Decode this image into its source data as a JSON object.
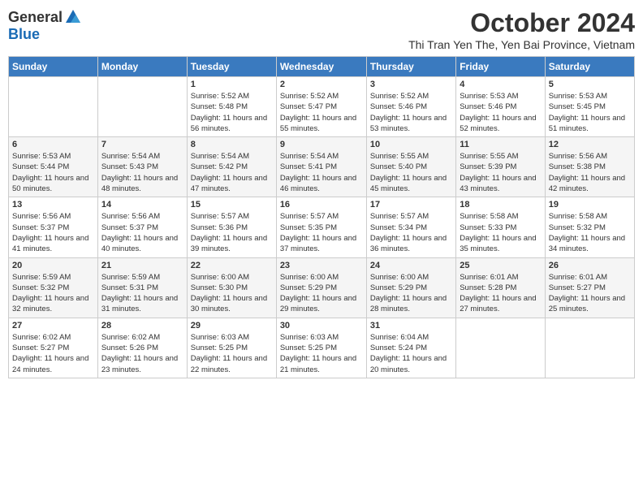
{
  "header": {
    "logo": {
      "general": "General",
      "blue": "Blue"
    },
    "title": "October 2024",
    "subtitle": "Thi Tran Yen The, Yen Bai Province, Vietnam"
  },
  "days_of_week": [
    "Sunday",
    "Monday",
    "Tuesday",
    "Wednesday",
    "Thursday",
    "Friday",
    "Saturday"
  ],
  "weeks": [
    [
      {
        "day": "",
        "info": ""
      },
      {
        "day": "",
        "info": ""
      },
      {
        "day": "1",
        "info": "Sunrise: 5:52 AM\nSunset: 5:48 PM\nDaylight: 11 hours and 56 minutes."
      },
      {
        "day": "2",
        "info": "Sunrise: 5:52 AM\nSunset: 5:47 PM\nDaylight: 11 hours and 55 minutes."
      },
      {
        "day": "3",
        "info": "Sunrise: 5:52 AM\nSunset: 5:46 PM\nDaylight: 11 hours and 53 minutes."
      },
      {
        "day": "4",
        "info": "Sunrise: 5:53 AM\nSunset: 5:46 PM\nDaylight: 11 hours and 52 minutes."
      },
      {
        "day": "5",
        "info": "Sunrise: 5:53 AM\nSunset: 5:45 PM\nDaylight: 11 hours and 51 minutes."
      }
    ],
    [
      {
        "day": "6",
        "info": "Sunrise: 5:53 AM\nSunset: 5:44 PM\nDaylight: 11 hours and 50 minutes."
      },
      {
        "day": "7",
        "info": "Sunrise: 5:54 AM\nSunset: 5:43 PM\nDaylight: 11 hours and 48 minutes."
      },
      {
        "day": "8",
        "info": "Sunrise: 5:54 AM\nSunset: 5:42 PM\nDaylight: 11 hours and 47 minutes."
      },
      {
        "day": "9",
        "info": "Sunrise: 5:54 AM\nSunset: 5:41 PM\nDaylight: 11 hours and 46 minutes."
      },
      {
        "day": "10",
        "info": "Sunrise: 5:55 AM\nSunset: 5:40 PM\nDaylight: 11 hours and 45 minutes."
      },
      {
        "day": "11",
        "info": "Sunrise: 5:55 AM\nSunset: 5:39 PM\nDaylight: 11 hours and 43 minutes."
      },
      {
        "day": "12",
        "info": "Sunrise: 5:56 AM\nSunset: 5:38 PM\nDaylight: 11 hours and 42 minutes."
      }
    ],
    [
      {
        "day": "13",
        "info": "Sunrise: 5:56 AM\nSunset: 5:37 PM\nDaylight: 11 hours and 41 minutes."
      },
      {
        "day": "14",
        "info": "Sunrise: 5:56 AM\nSunset: 5:37 PM\nDaylight: 11 hours and 40 minutes."
      },
      {
        "day": "15",
        "info": "Sunrise: 5:57 AM\nSunset: 5:36 PM\nDaylight: 11 hours and 39 minutes."
      },
      {
        "day": "16",
        "info": "Sunrise: 5:57 AM\nSunset: 5:35 PM\nDaylight: 11 hours and 37 minutes."
      },
      {
        "day": "17",
        "info": "Sunrise: 5:57 AM\nSunset: 5:34 PM\nDaylight: 11 hours and 36 minutes."
      },
      {
        "day": "18",
        "info": "Sunrise: 5:58 AM\nSunset: 5:33 PM\nDaylight: 11 hours and 35 minutes."
      },
      {
        "day": "19",
        "info": "Sunrise: 5:58 AM\nSunset: 5:32 PM\nDaylight: 11 hours and 34 minutes."
      }
    ],
    [
      {
        "day": "20",
        "info": "Sunrise: 5:59 AM\nSunset: 5:32 PM\nDaylight: 11 hours and 32 minutes."
      },
      {
        "day": "21",
        "info": "Sunrise: 5:59 AM\nSunset: 5:31 PM\nDaylight: 11 hours and 31 minutes."
      },
      {
        "day": "22",
        "info": "Sunrise: 6:00 AM\nSunset: 5:30 PM\nDaylight: 11 hours and 30 minutes."
      },
      {
        "day": "23",
        "info": "Sunrise: 6:00 AM\nSunset: 5:29 PM\nDaylight: 11 hours and 29 minutes."
      },
      {
        "day": "24",
        "info": "Sunrise: 6:00 AM\nSunset: 5:29 PM\nDaylight: 11 hours and 28 minutes."
      },
      {
        "day": "25",
        "info": "Sunrise: 6:01 AM\nSunset: 5:28 PM\nDaylight: 11 hours and 27 minutes."
      },
      {
        "day": "26",
        "info": "Sunrise: 6:01 AM\nSunset: 5:27 PM\nDaylight: 11 hours and 25 minutes."
      }
    ],
    [
      {
        "day": "27",
        "info": "Sunrise: 6:02 AM\nSunset: 5:27 PM\nDaylight: 11 hours and 24 minutes."
      },
      {
        "day": "28",
        "info": "Sunrise: 6:02 AM\nSunset: 5:26 PM\nDaylight: 11 hours and 23 minutes."
      },
      {
        "day": "29",
        "info": "Sunrise: 6:03 AM\nSunset: 5:25 PM\nDaylight: 11 hours and 22 minutes."
      },
      {
        "day": "30",
        "info": "Sunrise: 6:03 AM\nSunset: 5:25 PM\nDaylight: 11 hours and 21 minutes."
      },
      {
        "day": "31",
        "info": "Sunrise: 6:04 AM\nSunset: 5:24 PM\nDaylight: 11 hours and 20 minutes."
      },
      {
        "day": "",
        "info": ""
      },
      {
        "day": "",
        "info": ""
      }
    ]
  ]
}
